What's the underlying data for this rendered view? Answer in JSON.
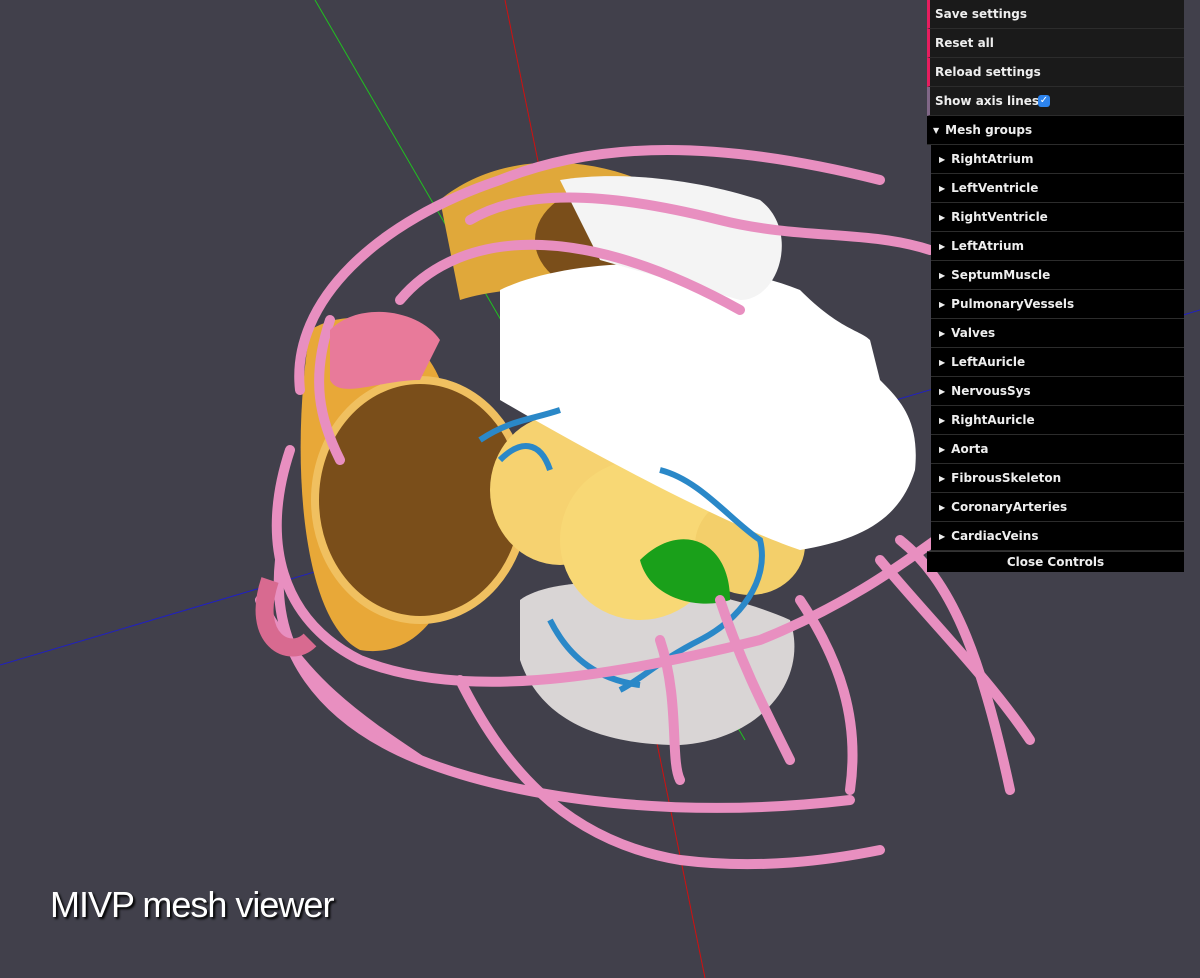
{
  "app": {
    "title": "MIVP mesh viewer"
  },
  "controls": {
    "buttons": [
      {
        "label": "Save settings"
      },
      {
        "label": "Reset all"
      },
      {
        "label": "Reload settings"
      }
    ],
    "show_axis": {
      "label": "Show axis lines",
      "checked": true
    },
    "mesh_folder": {
      "label": "Mesh groups",
      "expanded": true,
      "items": [
        {
          "label": "RightAtrium"
        },
        {
          "label": "LeftVentricle"
        },
        {
          "label": "RightVentricle"
        },
        {
          "label": "LeftAtrium"
        },
        {
          "label": "SeptumMuscle"
        },
        {
          "label": "PulmonaryVessels"
        },
        {
          "label": "Valves"
        },
        {
          "label": "LeftAuricle"
        },
        {
          "label": "NervousSys"
        },
        {
          "label": "RightAuricle"
        },
        {
          "label": "Aorta"
        },
        {
          "label": "FibrousSkeleton"
        },
        {
          "label": "CoronaryArteries"
        },
        {
          "label": "CardiacVeins"
        }
      ]
    },
    "close_label": "Close Controls"
  },
  "colors": {
    "background": "#41404b",
    "button_accent": "#e61d5f",
    "boolean_accent": "#806787",
    "checkbox": "#2d84ee",
    "axis_x": "#d01010",
    "axis_y": "#20c020",
    "axis_z": "#2020c0"
  }
}
